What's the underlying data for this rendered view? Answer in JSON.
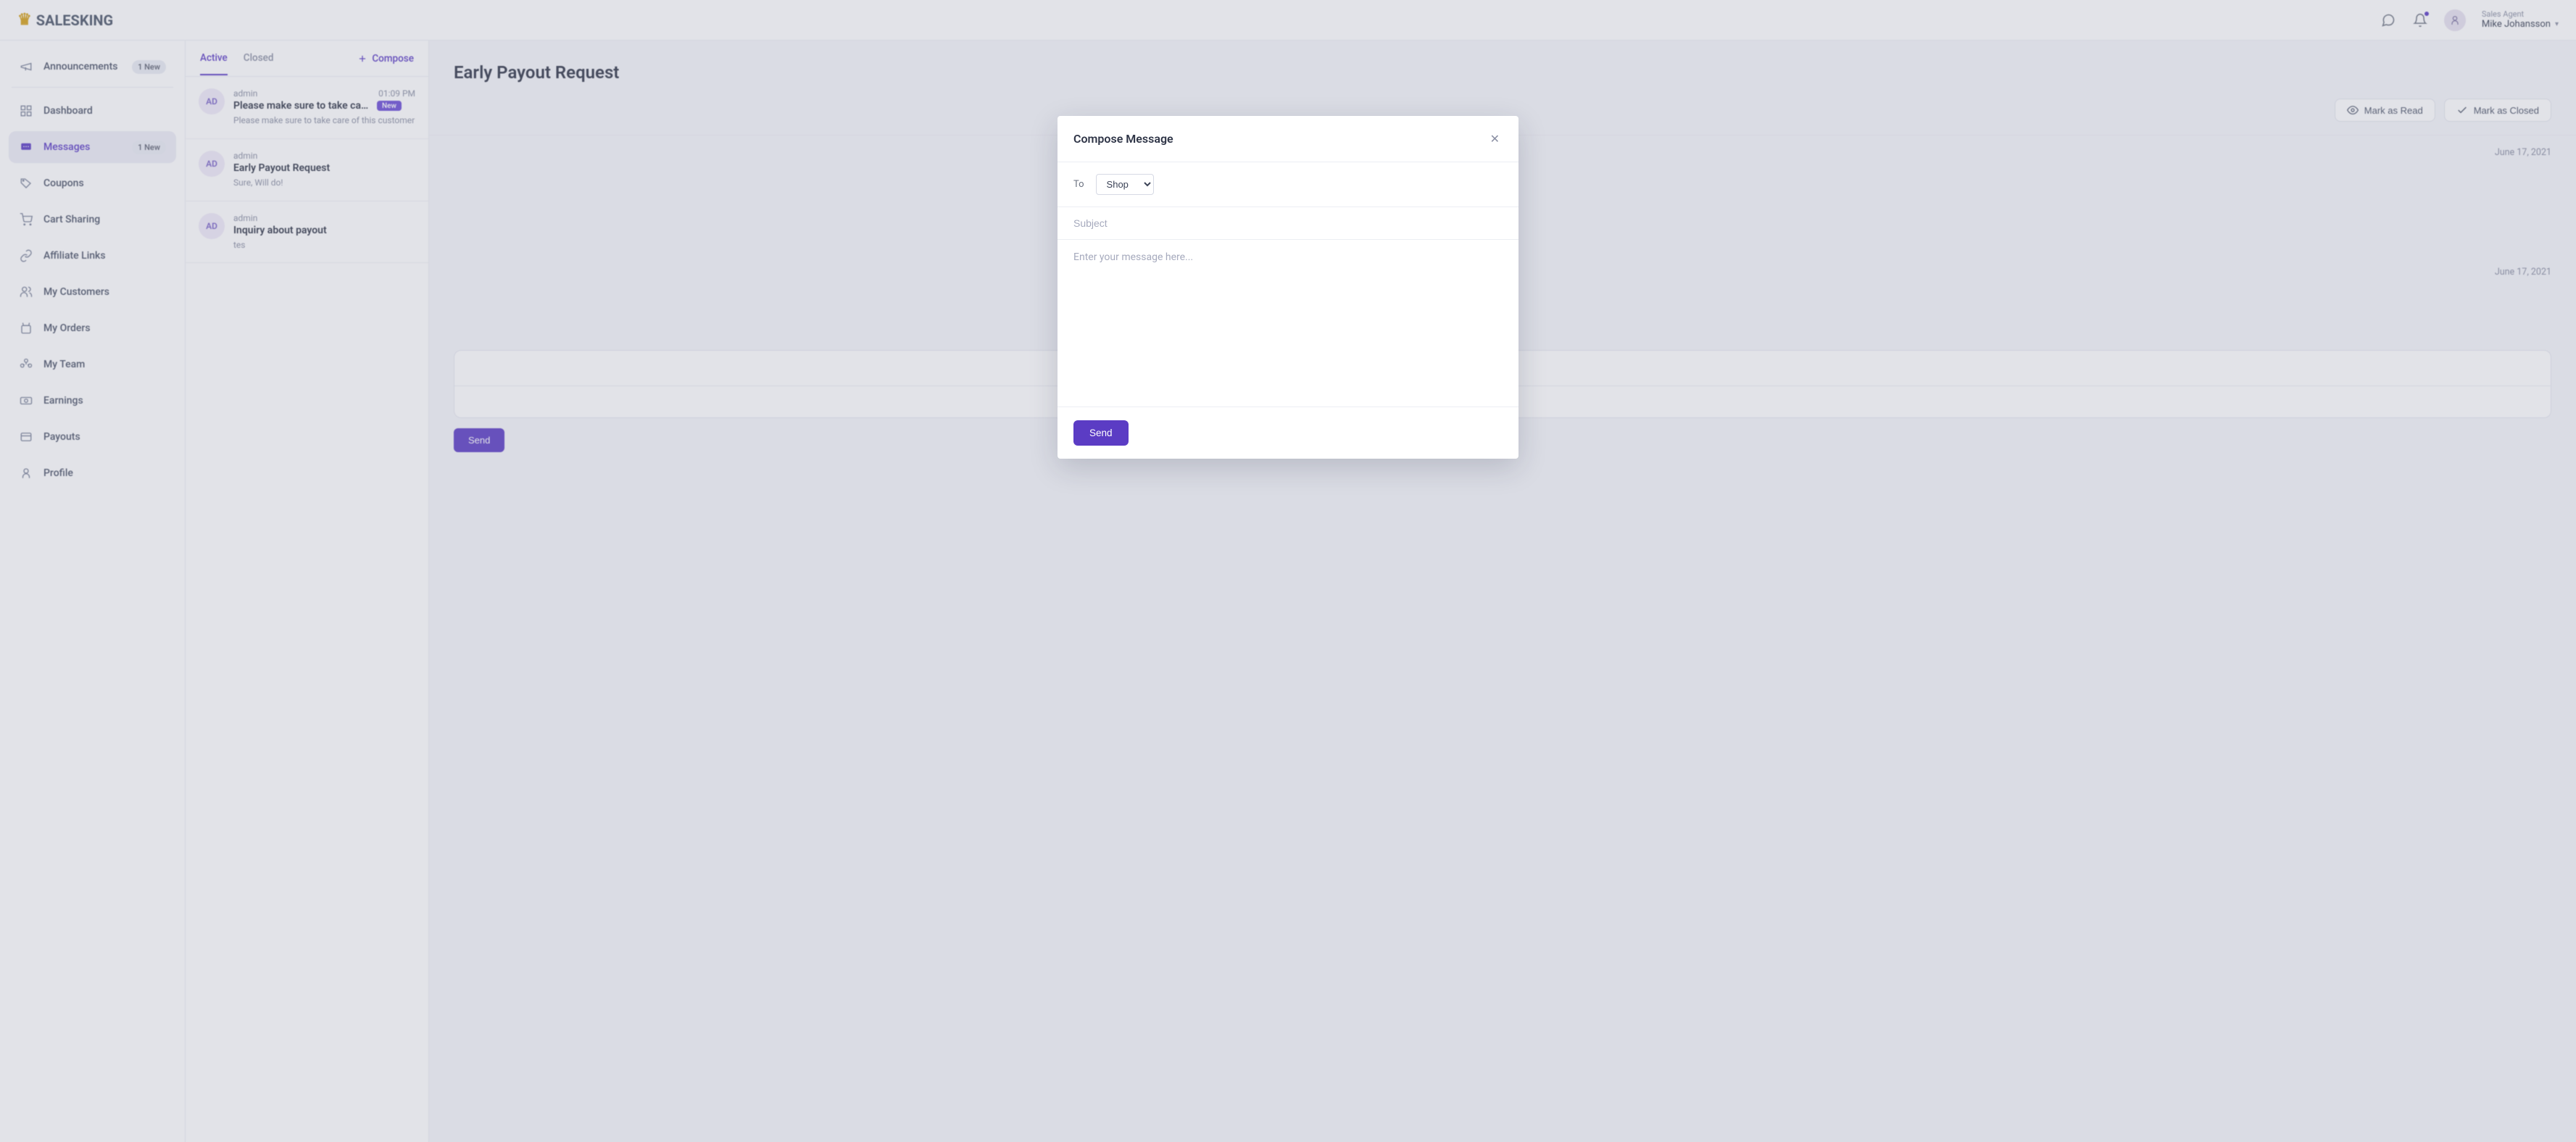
{
  "brand": {
    "name": "SALESKING"
  },
  "topbar": {
    "role": "Sales Agent",
    "user": "Mike Johansson"
  },
  "sidebar": {
    "items": [
      {
        "label": "Announcements",
        "badge": "1 New"
      },
      {
        "label": "Dashboard"
      },
      {
        "label": "Messages",
        "badge": "1 New",
        "active": true
      },
      {
        "label": "Coupons"
      },
      {
        "label": "Cart Sharing"
      },
      {
        "label": "Affiliate Links"
      },
      {
        "label": "My Customers"
      },
      {
        "label": "My Orders"
      },
      {
        "label": "My Team"
      },
      {
        "label": "Earnings"
      },
      {
        "label": "Payouts"
      },
      {
        "label": "Profile"
      }
    ]
  },
  "list": {
    "tabs": {
      "active": "Active",
      "closed": "Closed"
    },
    "compose": "Compose",
    "messages": [
      {
        "avatar": "AD",
        "from": "admin",
        "time": "01:09 PM",
        "subject": "Please make sure to take care ...",
        "badge": "New",
        "preview": "Please make sure to take care of this customer"
      },
      {
        "avatar": "AD",
        "from": "admin",
        "subject": "Early Payout Request",
        "preview": "Sure, Will do!"
      },
      {
        "avatar": "AD",
        "from": "admin",
        "subject": "Inquiry about payout",
        "preview": "tes"
      }
    ]
  },
  "thread": {
    "title": "Early Payout Request",
    "mark_read": "Mark as Read",
    "mark_closed": "Mark as Closed",
    "date1": "June 17, 2021",
    "date2": "June 17, 2021"
  },
  "modal": {
    "title": "Compose Message",
    "to_label": "To",
    "to_option": "Shop",
    "subject_placeholder": "Subject",
    "body_placeholder": "Enter your message here...",
    "send": "Send"
  }
}
